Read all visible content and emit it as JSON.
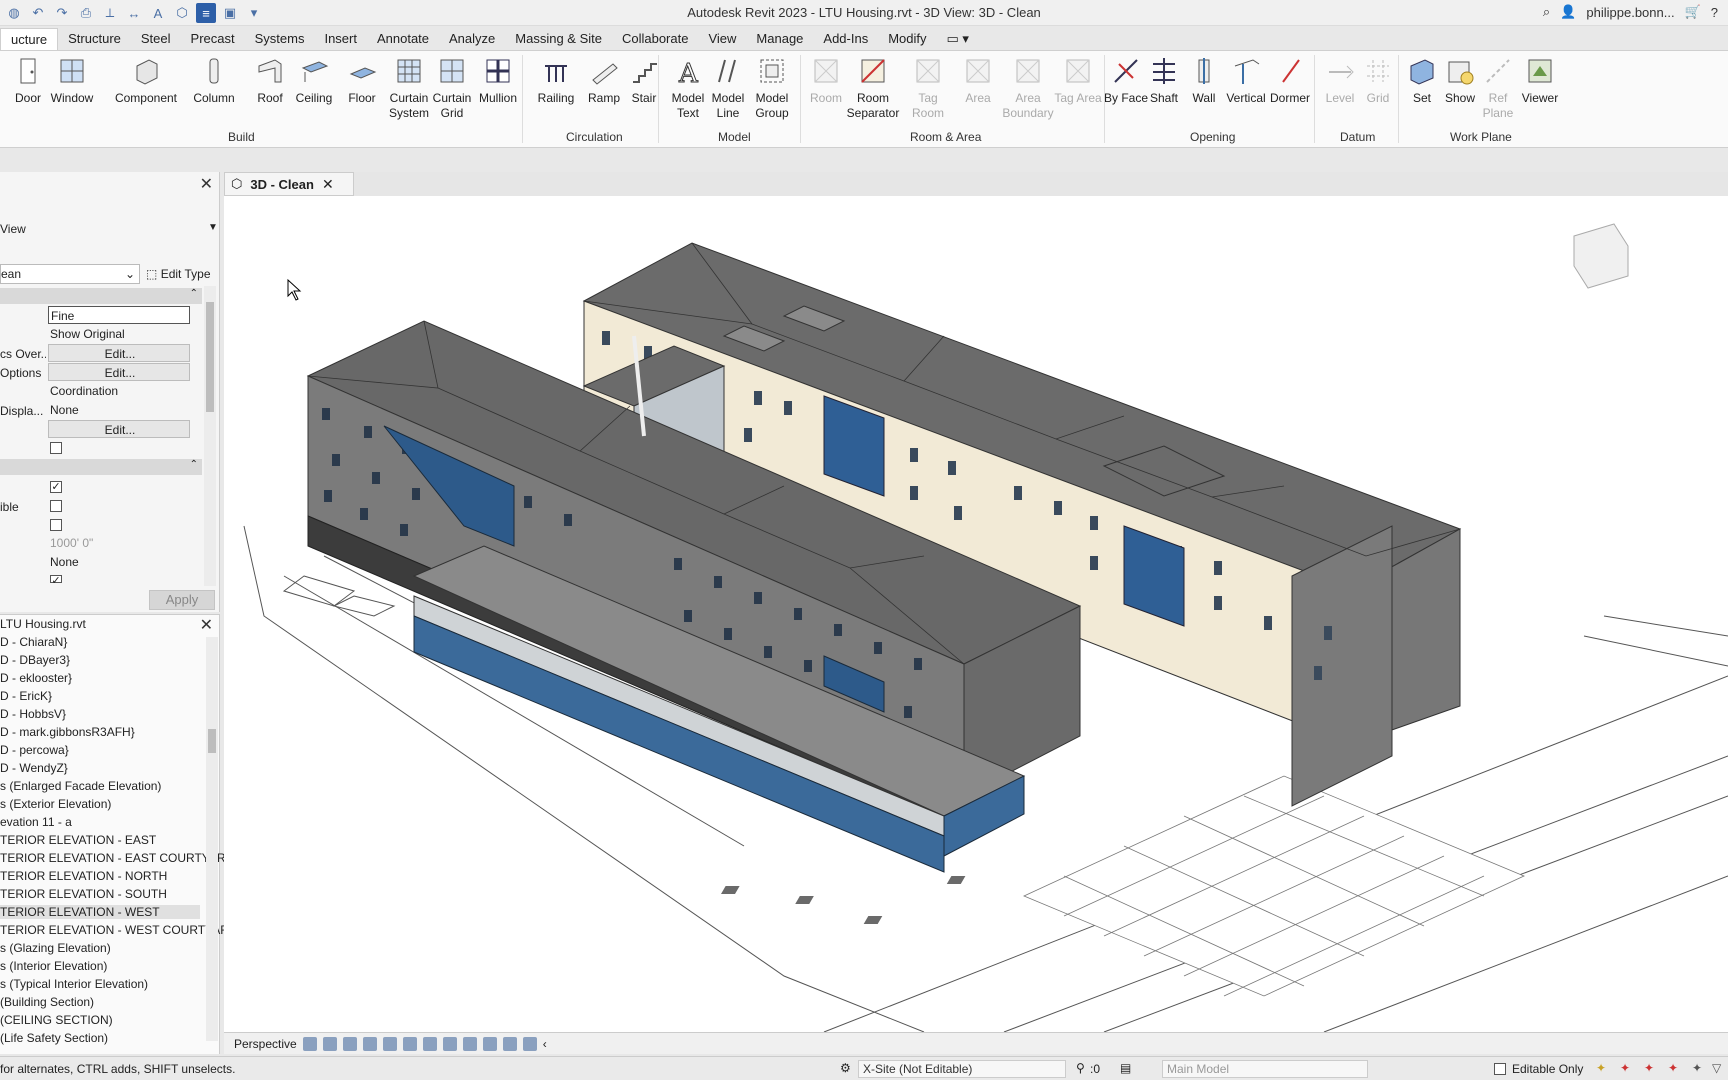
{
  "titlebar": {
    "title": "Autodesk Revit 2023 - LTU Housing.rvt - 3D View: 3D - Clean",
    "user": "philippe.bonn..."
  },
  "ribbon_tabs": [
    "ucture",
    "Structure",
    "Steel",
    "Precast",
    "Systems",
    "Insert",
    "Annotate",
    "Analyze",
    "Massing & Site",
    "Collaborate",
    "View",
    "Manage",
    "Add-Ins",
    "Modify"
  ],
  "ribbon": {
    "buttons": [
      {
        "label": "Door"
      },
      {
        "label": "Window"
      },
      {
        "label": "Component"
      },
      {
        "label": "Column"
      },
      {
        "label": "Roof"
      },
      {
        "label": "Ceiling"
      },
      {
        "label": "Floor"
      },
      {
        "label": "Curtain System"
      },
      {
        "label": "Curtain Grid"
      },
      {
        "label": "Mullion"
      },
      {
        "label": "Railing"
      },
      {
        "label": "Ramp"
      },
      {
        "label": "Stair"
      },
      {
        "label": "Model Text"
      },
      {
        "label": "Model Line"
      },
      {
        "label": "Model Group"
      },
      {
        "label": "Room"
      },
      {
        "label": "Room Separator"
      },
      {
        "label": "Tag Room"
      },
      {
        "label": "Area"
      },
      {
        "label": "Area Boundary"
      },
      {
        "label": "Tag Area"
      },
      {
        "label": "By Face"
      },
      {
        "label": "Shaft"
      },
      {
        "label": "Wall"
      },
      {
        "label": "Vertical"
      },
      {
        "label": "Dormer"
      },
      {
        "label": "Level"
      },
      {
        "label": "Grid"
      },
      {
        "label": "Set"
      },
      {
        "label": "Show"
      },
      {
        "label": "Ref Plane"
      },
      {
        "label": "Viewer"
      }
    ],
    "groups": [
      "Build",
      "Circulation",
      "Model",
      "Room & Area",
      "Opening",
      "Datum",
      "Work Plane"
    ]
  },
  "properties": {
    "type_label": "View",
    "type_selector": "ean",
    "edit_type": "Edit Type",
    "rows": {
      "detail_level": "Fine",
      "parts_visibility": "Show Original",
      "graphics_overrides_key": "cs Over...",
      "graphics_options_key": "Options",
      "edit": "Edit...",
      "discipline": "Coordination",
      "displacement_key": "Displa...",
      "displacement": "None",
      "visible_key": "ible",
      "far_clip": "1000'  0\"",
      "phase_filter": "None"
    },
    "apply": "Apply"
  },
  "browser": {
    "title": "LTU Housing.rvt",
    "items": [
      "D - ChiaraN}",
      "D - DBayer3}",
      "D - eklooster}",
      "D - EricK}",
      "D - HobbsV}",
      "D - mark.gibbonsR3AFH}",
      "D - percowa}",
      "D - WendyZ}",
      "s (Enlarged Facade Elevation)",
      "s (Exterior Elevation)",
      "evation 11 - a",
      "TERIOR ELEVATION - EAST",
      "TERIOR ELEVATION - EAST COURTYAR",
      "TERIOR ELEVATION - NORTH",
      "TERIOR ELEVATION - SOUTH",
      "TERIOR ELEVATION - WEST",
      "TERIOR ELEVATION - WEST COURTYAF",
      "s (Glazing Elevation)",
      "s (Interior Elevation)",
      "s (Typical Interior Elevation)",
      "(Building Section)",
      "(CEILING SECTION)",
      "(Life Safety Section)"
    ]
  },
  "view": {
    "tab_label": "3D - Clean",
    "view_mode": "Perspective"
  },
  "status": {
    "hint": "for alternates, CTRL adds, SHIFT unselects.",
    "workset": "X-Site (Not Editable)",
    "count": ":0",
    "model": "Main Model",
    "editable_only": "Editable Only"
  },
  "colors": {
    "accent": "#2d5fa8",
    "roof": "#6b6b6b",
    "wall": "#7a7a7a",
    "cladding": "#f5eedc",
    "glass": "#3a6ea5"
  }
}
